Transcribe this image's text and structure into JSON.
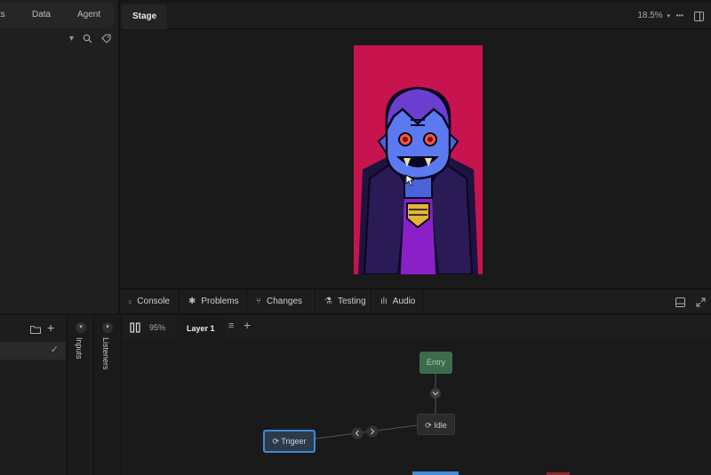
{
  "left_panel": {
    "tabs": [
      "ts",
      "Data",
      "Agent"
    ]
  },
  "stage": {
    "tab_label": "Stage",
    "zoom": "18.5%",
    "more_label": "•••"
  },
  "bottom_tabs": [
    {
      "icon": "console-icon",
      "label": "Console"
    },
    {
      "icon": "bug-icon",
      "label": "Problems"
    },
    {
      "icon": "branch-icon",
      "label": "Changes"
    },
    {
      "icon": "flask-icon",
      "label": "Testing"
    },
    {
      "icon": "audio-icon",
      "label": "Audio"
    }
  ],
  "state_machine": {
    "zoom": "95%",
    "layer_tab": "Layer 1",
    "inputs_label": "Inputs",
    "listeners_label": "Listeners",
    "nodes": {
      "entry": "Entry",
      "idle": "Idle",
      "trigger": "Trigeer"
    }
  },
  "colors": {
    "artboard_bg": "#c7134e",
    "entry_node": "#3f6b4d",
    "selected_outline": "#3d8bd9"
  }
}
